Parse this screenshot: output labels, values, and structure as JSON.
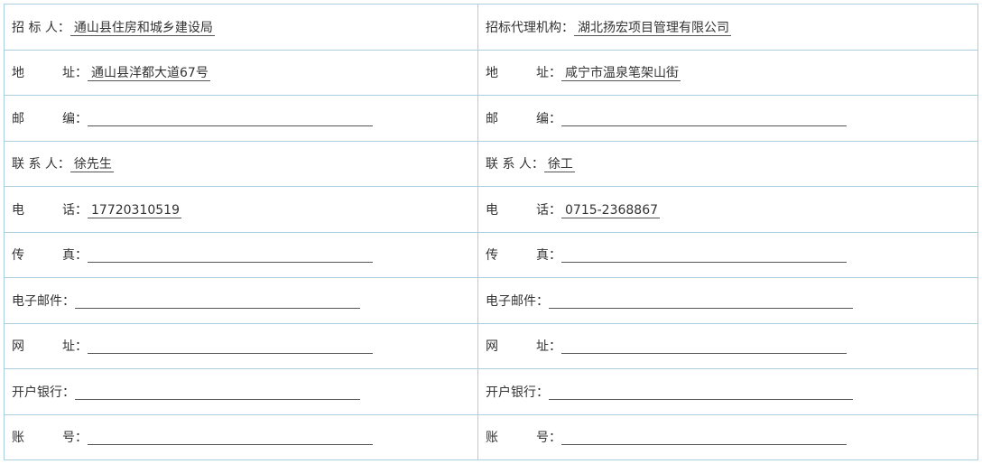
{
  "left": {
    "rows": [
      {
        "label": "招 标 人：",
        "value": "通山县住房和城乡建设局"
      },
      {
        "label": "地　　　址：",
        "value": "通山县洋都大道67号"
      },
      {
        "label": "邮　　　编：",
        "value": ""
      },
      {
        "label": "联 系 人：",
        "value": "徐先生"
      },
      {
        "label": "电　　　话：",
        "value": "17720310519"
      },
      {
        "label": "传　　　真：",
        "value": ""
      },
      {
        "label": "电子邮件：",
        "value": ""
      },
      {
        "label": "网　　　址：",
        "value": ""
      },
      {
        "label": "开户银行：",
        "value": ""
      },
      {
        "label": "账　　　号：",
        "value": ""
      }
    ]
  },
  "right": {
    "rows": [
      {
        "label": "招标代理机构：",
        "value": "湖北扬宏项目管理有限公司"
      },
      {
        "label": "地　　　址：",
        "value": "咸宁市温泉笔架山街"
      },
      {
        "label": "邮　　　编：",
        "value": ""
      },
      {
        "label": "联 系 人：",
        "value": "徐工"
      },
      {
        "label": "电　　　话：",
        "value": "0715-2368867"
      },
      {
        "label": "传　　　真：",
        "value": ""
      },
      {
        "label": "电子邮件：",
        "value": ""
      },
      {
        "label": "网　　　址：",
        "value": ""
      },
      {
        "label": "开户银行：",
        "value": ""
      },
      {
        "label": "账　　　号：",
        "value": ""
      }
    ]
  }
}
